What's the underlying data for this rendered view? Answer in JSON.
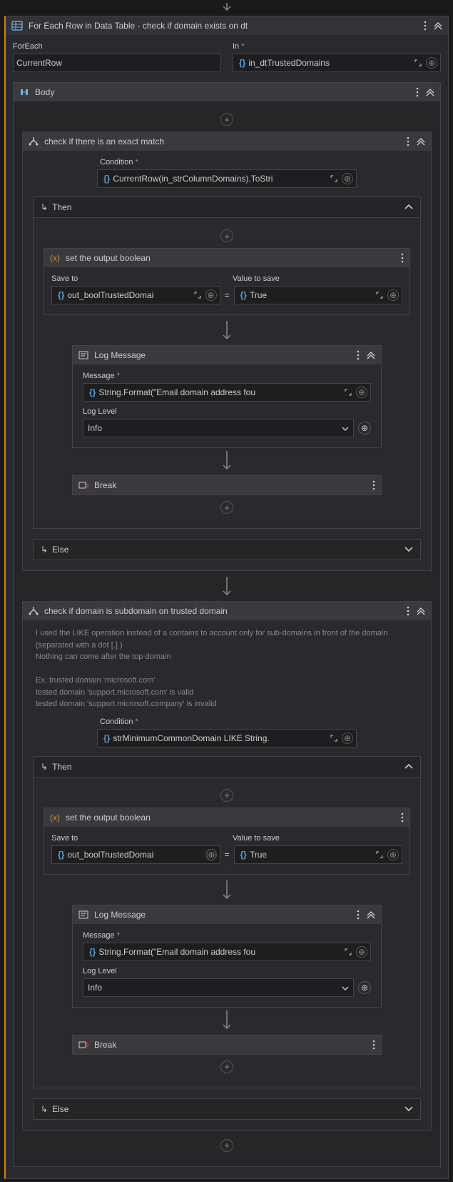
{
  "top_arrow": true,
  "foreach_card": {
    "title": "For Each Row in Data Table - check if domain exists on dt",
    "foreach_label": "ForEach",
    "foreach_value": "CurrentRow",
    "in_label": "In",
    "in_value": "in_dtTrustedDomains"
  },
  "body_title": "Body",
  "if1": {
    "title": "check if there is an exact match",
    "condition_label": "Condition",
    "condition_value": "CurrentRow(in_strColumnDomains).ToStri",
    "then_label": "Then",
    "else_label": "Else",
    "assign": {
      "title": "set the output boolean",
      "save_to_label": "Save to",
      "save_to_value": "out_boolTrustedDomai",
      "value_label": "Value to save",
      "value_value": "True"
    },
    "log": {
      "title": "Log Message",
      "message_label": "Message",
      "message_value": "String.Format(\"Email domain address fou",
      "level_label": "Log Level",
      "level_value": "Info"
    },
    "break_label": "Break"
  },
  "if2": {
    "title": "check if domain is subdomain on trusted domain",
    "note_l1": "I used the LIKE operation instead of a contains to account only  for sub-domains in front of the domain (separated with a dot [.] )",
    "note_l2": "Nothing can come after the top domain",
    "note_l3": "Ex.  trusted domain 'microsoft.com'",
    "note_l4": "tested domain 'support.microsoft.com' is valid",
    "note_l5": "tested domain 'support.microsoft.company' is invalid",
    "condition_label": "Condition",
    "condition_value": "strMinimumCommonDomain LIKE String.",
    "then_label": "Then",
    "else_label": "Else",
    "assign": {
      "title": "set the output boolean",
      "save_to_label": "Save to",
      "save_to_value": "out_boolTrustedDomai",
      "value_label": "Value to save",
      "value_value": "True"
    },
    "log": {
      "title": "Log Message",
      "message_label": "Message",
      "message_value": "String.Format(\"Email domain address fou",
      "level_label": "Log Level",
      "level_value": "Info"
    },
    "break_label": "Break"
  }
}
